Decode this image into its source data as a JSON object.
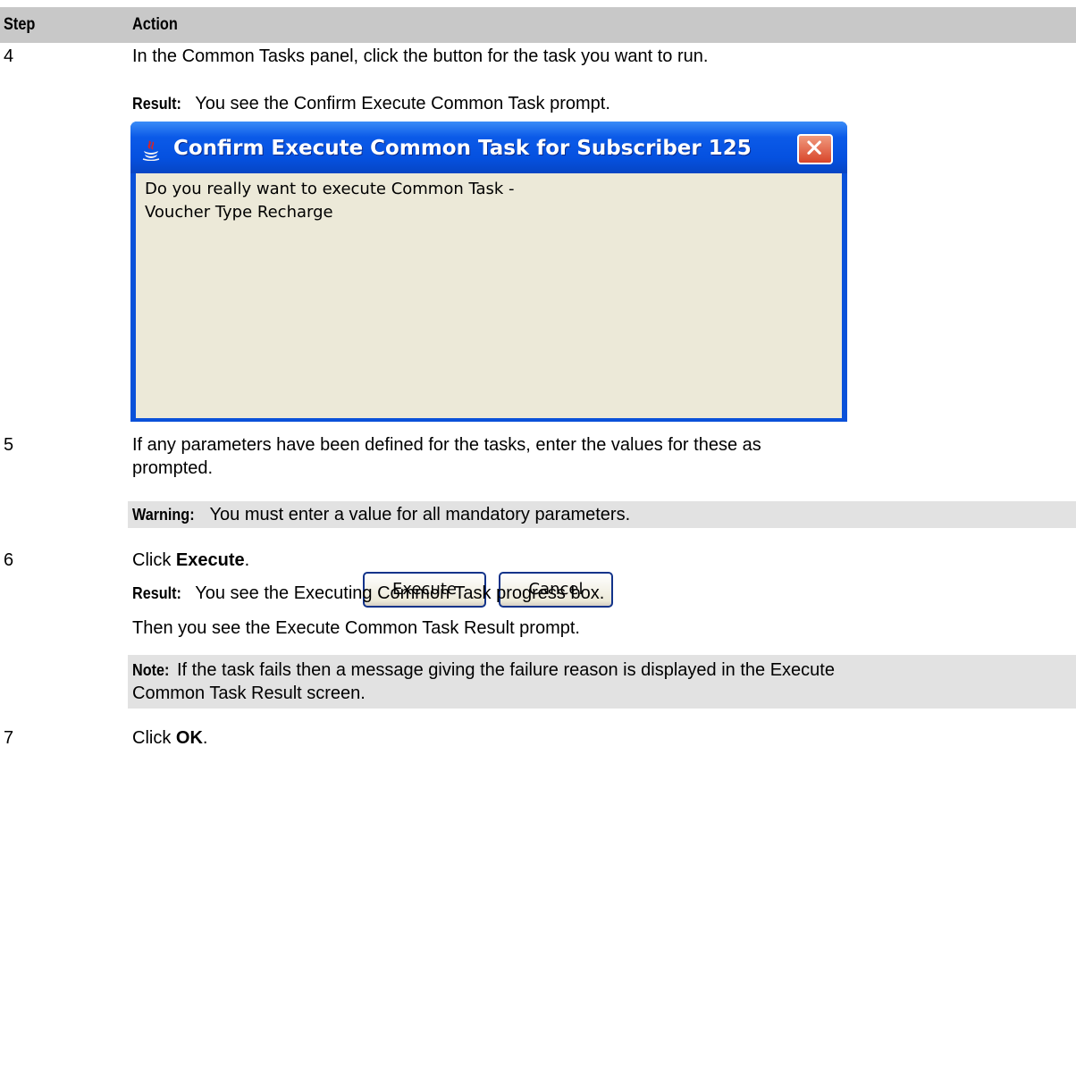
{
  "header": {
    "step": "Step",
    "action": "Action"
  },
  "rows": [
    {
      "step": "4",
      "action": "In the Common Tasks panel, click the button for the task you want to run.",
      "result_label": "Result:",
      "result_text": "You see the Confirm Execute Common Task prompt."
    },
    {
      "step": "5",
      "action_line1": "If any parameters have been defined for the tasks, enter the values for these as",
      "action_line2": "prompted.",
      "warning_label": "Warning:",
      "warning_text": "You must enter a value for all mandatory parameters."
    },
    {
      "step": "6",
      "action_prefix": "Click ",
      "action_bold": "Execute",
      "action_suffix": ".",
      "result_label": "Result:",
      "result_text": "You see the Executing Common Task progress box.",
      "then_text": "Then you see the Execute Common Task Result prompt.",
      "note_label": "Note:",
      "note_line1": "If the task fails then a message giving the failure reason is displayed in the Execute",
      "note_line2": "Common Task Result screen."
    },
    {
      "step": "7",
      "action_prefix": "Click ",
      "action_bold": "OK",
      "action_suffix": "."
    }
  ],
  "dialog": {
    "title": "Confirm Execute Common Task for Subscriber 125",
    "icon": "java-icon",
    "message_line1": "Do you really want to execute Common Task -",
    "message_line2": "Voucher Type Recharge",
    "execute_label": "Execute",
    "cancel_label": "Cancel"
  }
}
